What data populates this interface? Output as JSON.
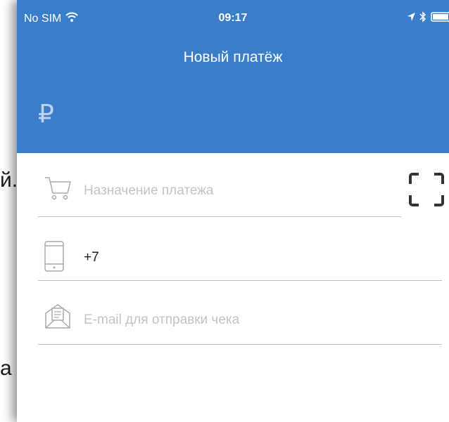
{
  "background": {
    "fragment_1": "й.",
    "fragment_2": "а"
  },
  "status_bar": {
    "carrier": "No SIM",
    "time": "09:17"
  },
  "header": {
    "title": "Новый платёж",
    "currency_symbol": "₽"
  },
  "form": {
    "purpose": {
      "value": "",
      "placeholder": "Назначение платежа",
      "icon": "shopping-cart-icon"
    },
    "phone": {
      "value": "+7",
      "icon": "phone-icon"
    },
    "email": {
      "value": "",
      "placeholder": "E-mail для отправки чека",
      "icon": "envelope-receipt-icon"
    }
  },
  "scan": {
    "icon": "scan-frame-icon"
  },
  "colors": {
    "header": "#3a7dcb",
    "currency": "#bcd3ef",
    "placeholder": "#c4c4c4",
    "icon": "#aaaaaa"
  }
}
